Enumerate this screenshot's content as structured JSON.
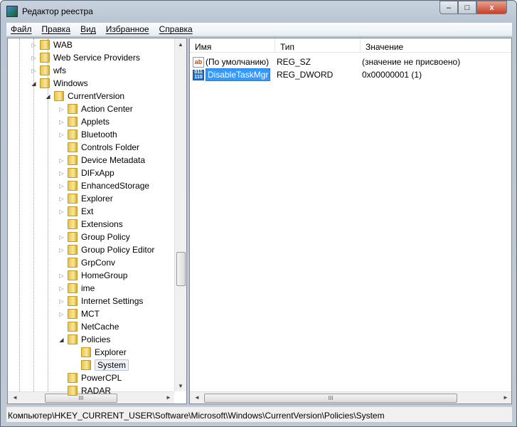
{
  "window": {
    "title": "Редактор реестра",
    "minimize": "–",
    "maximize": "□",
    "close": "x"
  },
  "menu": [
    "Файл",
    "Правка",
    "Вид",
    "Избранное",
    "Справка"
  ],
  "tree": [
    {
      "label": "WAB",
      "level": 0,
      "expander": "collapsed"
    },
    {
      "label": "Web Service Providers",
      "level": 0,
      "expander": "collapsed"
    },
    {
      "label": "wfs",
      "level": 0,
      "expander": "collapsed"
    },
    {
      "label": "Windows",
      "level": 0,
      "expander": "expanded"
    },
    {
      "label": "CurrentVersion",
      "level": 1,
      "expander": "expanded"
    },
    {
      "label": "Action Center",
      "level": 2,
      "expander": "collapsed"
    },
    {
      "label": "Applets",
      "level": 2,
      "expander": "collapsed"
    },
    {
      "label": "Bluetooth",
      "level": 2,
      "expander": "collapsed"
    },
    {
      "label": "Controls Folder",
      "level": 2,
      "expander": "none"
    },
    {
      "label": "Device Metadata",
      "level": 2,
      "expander": "collapsed"
    },
    {
      "label": "DIFxApp",
      "level": 2,
      "expander": "collapsed"
    },
    {
      "label": "EnhancedStorage",
      "level": 2,
      "expander": "collapsed"
    },
    {
      "label": "Explorer",
      "level": 2,
      "expander": "collapsed"
    },
    {
      "label": "Ext",
      "level": 2,
      "expander": "collapsed"
    },
    {
      "label": "Extensions",
      "level": 2,
      "expander": "none"
    },
    {
      "label": "Group Policy",
      "level": 2,
      "expander": "collapsed"
    },
    {
      "label": "Group Policy Editor",
      "level": 2,
      "expander": "collapsed"
    },
    {
      "label": "GrpConv",
      "level": 2,
      "expander": "none"
    },
    {
      "label": "HomeGroup",
      "level": 2,
      "expander": "collapsed"
    },
    {
      "label": "ime",
      "level": 2,
      "expander": "collapsed"
    },
    {
      "label": "Internet Settings",
      "level": 2,
      "expander": "collapsed"
    },
    {
      "label": "MCT",
      "level": 2,
      "expander": "collapsed"
    },
    {
      "label": "NetCache",
      "level": 2,
      "expander": "none"
    },
    {
      "label": "Policies",
      "level": 2,
      "expander": "expanded"
    },
    {
      "label": "Explorer",
      "level": 3,
      "expander": "none"
    },
    {
      "label": "System",
      "level": 3,
      "expander": "none",
      "selected": true
    },
    {
      "label": "PowerCPL",
      "level": 2,
      "expander": "none"
    },
    {
      "label": "RADAR",
      "level": 2,
      "expander": "none"
    }
  ],
  "list": {
    "columns": [
      "Имя",
      "Тип",
      "Значение"
    ],
    "rows": [
      {
        "icon": "string-value-icon",
        "name": "(По умолчанию)",
        "type": "REG_SZ",
        "value": "(значение не присвоено)"
      },
      {
        "icon": "binary-value-icon",
        "name": "DisableTaskMgr",
        "type": "REG_DWORD",
        "value": "0x00000001 (1)",
        "selected": true
      }
    ]
  },
  "status": "Компьютер\\HKEY_CURRENT_USER\\Software\\Microsoft\\Windows\\CurrentVersion\\Policies\\System",
  "scrollbar_glyphs": {
    "up": "▲",
    "down": "▼",
    "left": "◄",
    "right": "►",
    "grip": "III"
  }
}
